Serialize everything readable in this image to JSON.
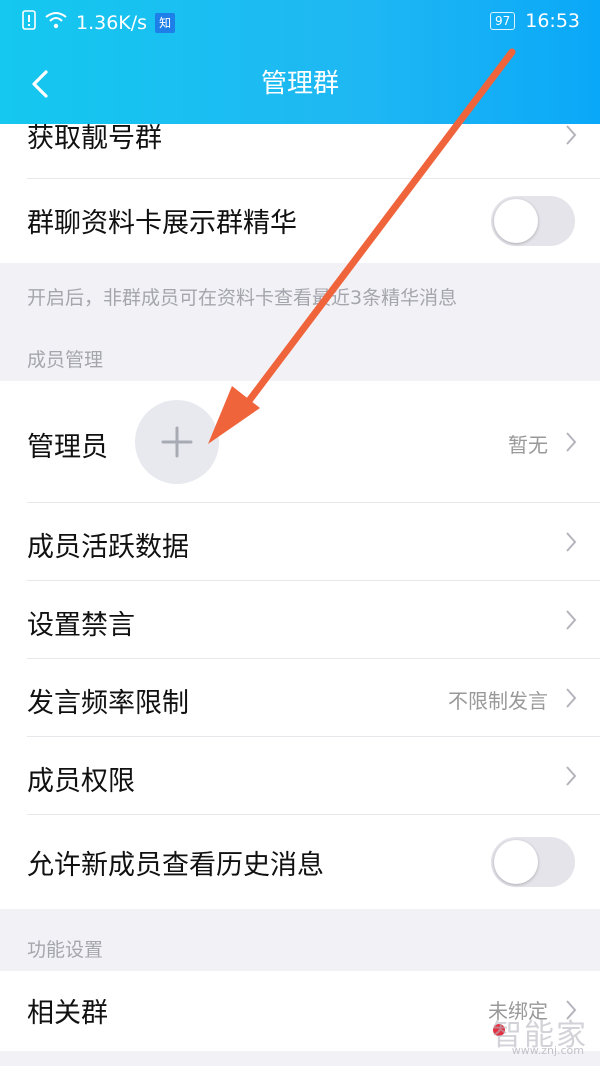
{
  "status_bar": {
    "network_speed": "1.36K/s",
    "notification_badge": "知",
    "battery": "97",
    "time": "16:53",
    "icons": [
      "sim-alert-icon",
      "wifi-icon",
      "battery-icon"
    ]
  },
  "nav": {
    "title": "管理群",
    "back_icon": "chevron-left-icon"
  },
  "rows_top": {
    "pretty_number_group": "获取靓号群",
    "show_essence": "群聊资料卡展示群精华",
    "show_essence_on": false
  },
  "notes": {
    "essence_hint": "开启后，非群成员可在资料卡查看最近3条精华消息"
  },
  "sections": {
    "member_management": "成员管理",
    "feature_settings": "功能设置"
  },
  "member_rows": {
    "admin": {
      "label": "管理员",
      "value": "暂无"
    },
    "activity": {
      "label": "成员活跃数据"
    },
    "mute": {
      "label": "设置禁言"
    },
    "rate_limit": {
      "label": "发言频率限制",
      "value": "不限制发言"
    },
    "permissions": {
      "label": "成员权限"
    },
    "history": {
      "label": "允许新成员查看历史消息",
      "on": false
    }
  },
  "feature_rows": {
    "related_group": {
      "label": "相关群",
      "value": "未绑定"
    }
  },
  "watermark": {
    "text": "智能家",
    "url": "www.znj.com"
  },
  "colors": {
    "header_start": "#14c8ef",
    "header_end": "#0aa8f8",
    "annotation_arrow": "#f0643c"
  }
}
